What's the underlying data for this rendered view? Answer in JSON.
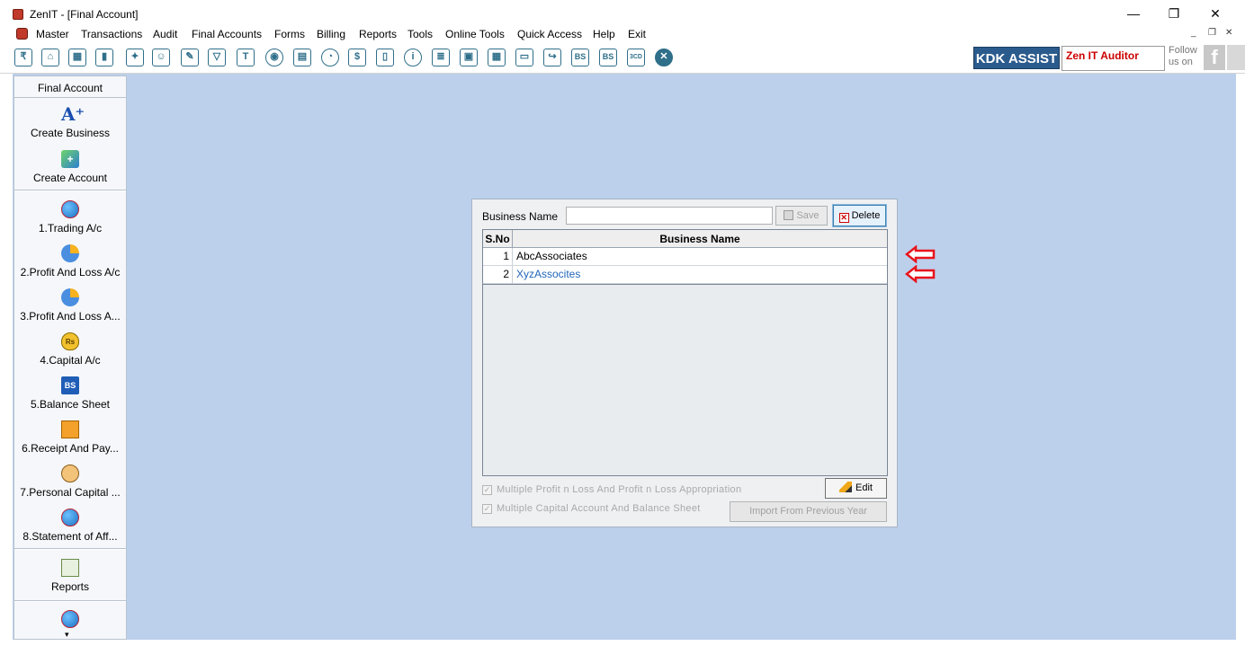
{
  "window": {
    "title": "ZenIT - [Final Account]",
    "minimize_icon": "minimize-icon",
    "maximize_icon": "restore-icon",
    "close_icon": "close-icon",
    "minimize_glyph": "—",
    "restore_glyph": "❐",
    "close_glyph": "✕"
  },
  "menubar": {
    "items": [
      "Master",
      "Transactions",
      "Audit",
      "Final Accounts",
      "Forms",
      "Billing",
      "Reports",
      "Tools",
      "Online Tools",
      "Quick Access",
      "Help",
      "Exit"
    ],
    "mdi": {
      "min": "_",
      "restore": "❐",
      "close": "✕"
    }
  },
  "toolbar": {
    "icons": [
      "rupee-icon",
      "home-icon",
      "building-icon",
      "bar-chart-icon",
      "gift-icon",
      "users-icon",
      "pin-icon",
      "filter-icon",
      "tax-icon",
      "toggle-icon",
      "calculator-icon",
      "pie-chart-icon",
      "pay-icon",
      "book-icon",
      "info-icon",
      "document-icon",
      "report-user-icon",
      "calendar-icon",
      "add-folder-icon",
      "export-icon",
      "bs-icon",
      "bs-sch-icon",
      "3cd-icon",
      "close-circle-icon"
    ],
    "glyphs": [
      "₹",
      "⌂",
      "▦",
      "▮",
      "✦",
      "☺",
      "✎",
      "▽",
      "T",
      "◉",
      "▤",
      "◔",
      "$",
      "▯",
      "i",
      "≣",
      "▣",
      "▦",
      "▭",
      "↪",
      "BS",
      "BS",
      "3CD",
      "✕"
    ],
    "kdk_label": "KDK ASSIST",
    "zen_auditor_label": "Zen IT Auditor",
    "follow_line1": "Follow",
    "follow_line2": "us on",
    "fb_glyph": "f"
  },
  "sidebar": {
    "header": "Final Account",
    "top_items": [
      {
        "label": "Create Business",
        "icon": "font-add-icon",
        "glyph": "A⁺"
      },
      {
        "label": "Create Account",
        "icon": "add-account-icon",
        "glyph": "+"
      }
    ],
    "items": [
      {
        "label": "1.Trading A/c",
        "icon": "globe-book-icon"
      },
      {
        "label": "2.Profit And Loss A/c",
        "icon": "pie-chart-icon"
      },
      {
        "label": "3.Profit And Loss A...",
        "icon": "pie-chart-icon"
      },
      {
        "label": "4.Capital A/c",
        "icon": "money-bag-icon",
        "glyph": "Rs"
      },
      {
        "label": "5.Balance Sheet",
        "icon": "balance-sheet-icon",
        "glyph": "BS"
      },
      {
        "label": "6.Receipt And Pay...",
        "icon": "receipt-icon"
      },
      {
        "label": "7.Personal Capital ...",
        "icon": "person-icon"
      },
      {
        "label": "8.Statement of Aff...",
        "icon": "globe-book-icon"
      }
    ],
    "reports_label": "Reports",
    "more_icon": "globe-book-icon",
    "scroll_glyph": "▾"
  },
  "dialog": {
    "business_name_label": "Business Name",
    "business_name_value": "",
    "save_label": "Save",
    "delete_label": "Delete",
    "delete_glyph": "✕",
    "grid": {
      "columns": [
        "S.No",
        "Business Name"
      ],
      "rows": [
        {
          "sno": "1",
          "name": "AbcAssociates"
        },
        {
          "sno": "2",
          "name": "XyzAssocites"
        }
      ]
    },
    "check1_label": "Multiple Profit n Loss And Profit n Loss Appropriation",
    "check2_label": "Multiple Capital Account And Balance Sheet",
    "check_glyph": "✓",
    "edit_label": "Edit",
    "import_label": "Import From Previous Year"
  },
  "annotations": {
    "arrow_color": "#e8141c"
  }
}
